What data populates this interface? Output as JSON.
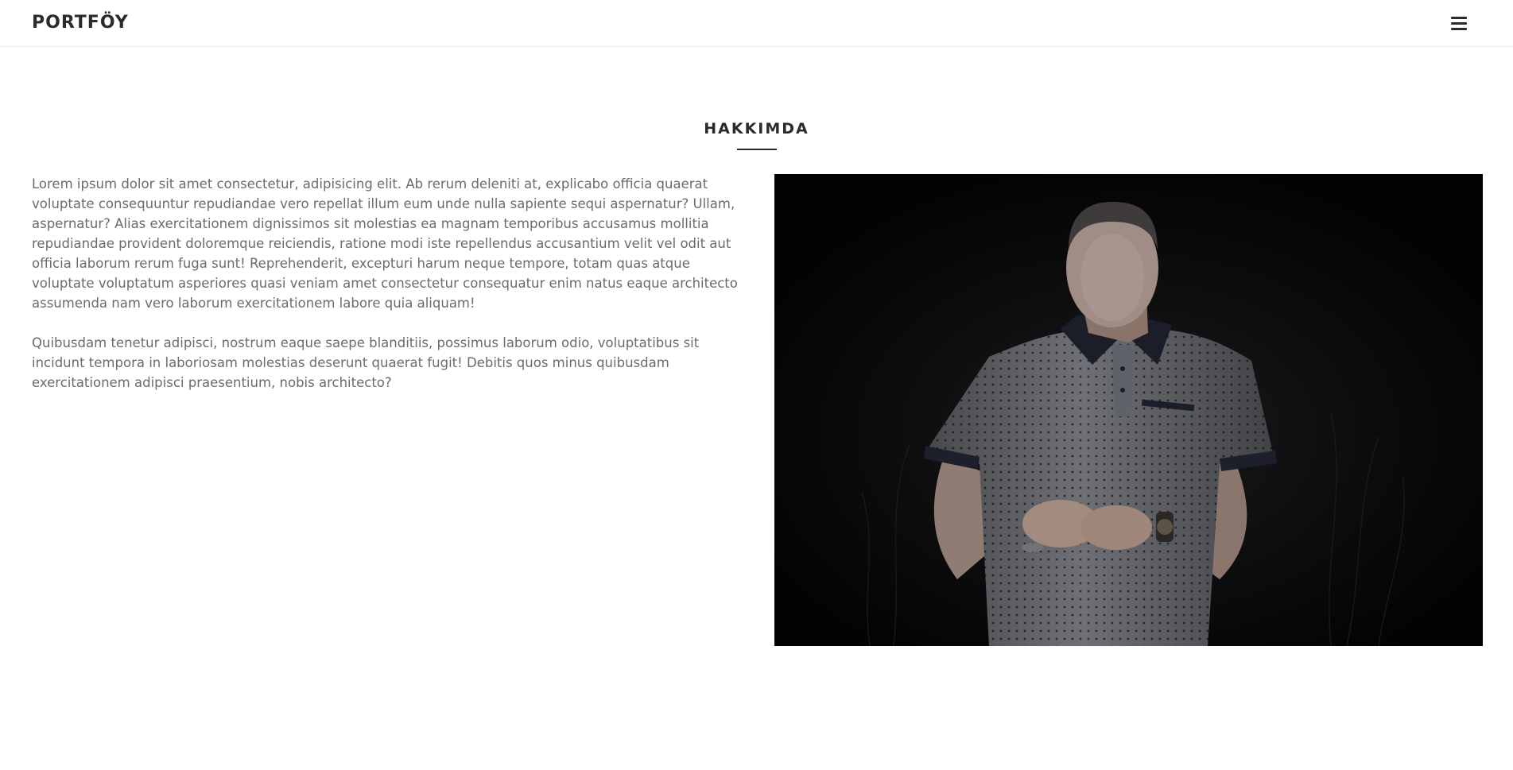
{
  "navbar": {
    "brand": "PORTFÖY",
    "menu_icon": "hamburger-menu-icon"
  },
  "about": {
    "title": "HAKKIMDA",
    "paragraphs": [
      "Lorem ipsum dolor sit amet consectetur, adipisicing elit. Ab rerum deleniti at, explicabo officia quaerat voluptate consequuntur repudiandae vero repellat illum eum unde nulla sapiente sequi aspernatur? Ullam, aspernatur? Alias exercitationem dignissimos sit molestias ea magnam temporibus accusamus mollitia repudiandae provident doloremque reiciendis, ratione modi iste repellendus accusantium velit vel odit aut officia laborum rerum fuga sunt! Reprehenderit, excepturi harum neque tempore, totam quas atque voluptate voluptatum asperiores quasi veniam amet consectetur consequatur enim natus eaque architecto assumenda nam vero laborum exercitationem labore quia aliquam!",
      "Quibusdam tenetur adipisci, nostrum eaque saepe blanditiis, possimus laborum odio, voluptatibus sit incidunt tempora in laboriosam molestias deserunt quaerat fugit! Debitis quos minus quibusdam exercitationem adipisci praesentium, nobis architecto?"
    ]
  },
  "colors": {
    "text_dark": "#2b2b2b",
    "text_body": "#6b6b6b",
    "photo_background": "#020203"
  }
}
